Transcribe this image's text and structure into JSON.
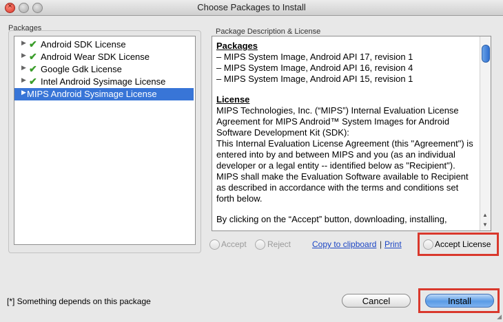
{
  "window": {
    "title": "Choose Packages to Install"
  },
  "packages": {
    "label": "Packages",
    "items": [
      {
        "label": "Android SDK License",
        "accepted": true,
        "selected": false
      },
      {
        "label": "Android Wear SDK License",
        "accepted": true,
        "selected": false
      },
      {
        "label": "Google Gdk License",
        "accepted": true,
        "selected": false
      },
      {
        "label": "Intel Android Sysimage License",
        "accepted": true,
        "selected": false
      },
      {
        "label": "MIPS Android Sysimage License",
        "accepted": false,
        "selected": true
      }
    ]
  },
  "description": {
    "label": "Package Description & License",
    "packages_heading": "Packages",
    "packages_lines": [
      "– MIPS System Image, Android API 17, revision 1",
      "– MIPS System Image, Android API 16, revision 4",
      "– MIPS System Image, Android API 15, revision 1"
    ],
    "license_heading": "License",
    "license_paragraphs": [
      "MIPS Technologies, Inc. (“MIPS”) Internal Evaluation License Agreement for MIPS Android™ System Images for Android Software Development Kit (SDK):",
      "This Internal Evaluation License Agreement (this \"Agreement\") is entered into by and between MIPS and you (as an individual developer or a legal entity -- identified below as \"Recipient\"). MIPS shall make the Evaluation Software available to Recipient as described in accordance with the terms and conditions set forth below."
    ],
    "trailing_line": "By clicking on the “Accept” button, downloading, installing,"
  },
  "controls": {
    "accept_label": "Accept",
    "reject_label": "Reject",
    "copy_label": "Copy to clipboard",
    "separator": "|",
    "print_label": "Print",
    "accept_license_label": "Accept License"
  },
  "footer": {
    "note": "[*] Something depends on this package",
    "cancel_label": "Cancel",
    "install_label": "Install"
  },
  "colors": {
    "selection": "#3875d7",
    "highlight_box": "#d9382c",
    "link": "#1b45c4",
    "check": "#3a9d2a"
  }
}
